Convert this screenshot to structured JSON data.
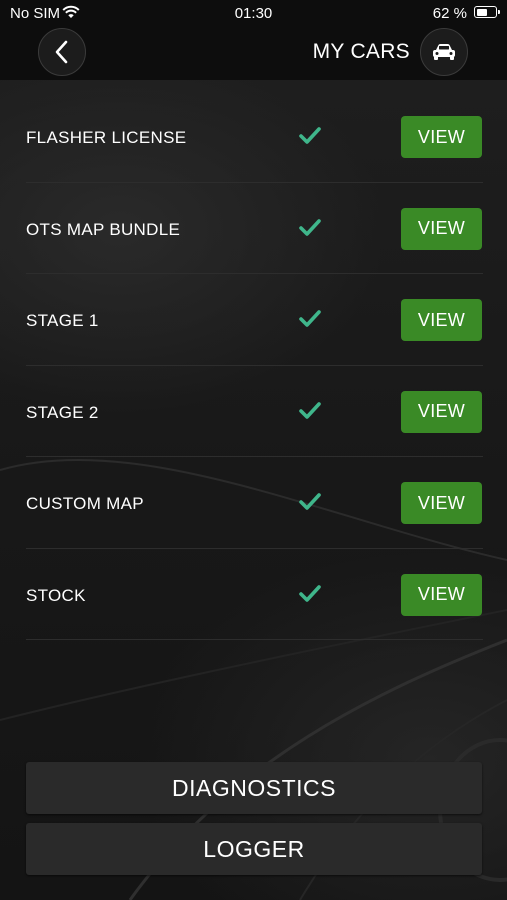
{
  "status_bar": {
    "carrier": "No SIM",
    "time": "01:30",
    "battery_percent": "62 %",
    "battery_level": 0.62
  },
  "header": {
    "title": "MY CARS",
    "back_icon": "chevron-left-icon",
    "car_icon": "car-icon"
  },
  "rows": [
    {
      "label": "FLASHER LICENSE",
      "button": "VIEW"
    },
    {
      "label": "OTS MAP BUNDLE",
      "button": "VIEW"
    },
    {
      "label": "STAGE 1",
      "button": "VIEW"
    },
    {
      "label": "STAGE 2",
      "button": "VIEW"
    },
    {
      "label": "CUSTOM MAP",
      "button": "VIEW"
    },
    {
      "label": "STOCK",
      "button": "VIEW"
    }
  ],
  "actions": {
    "diagnostics": "DIAGNOSTICS",
    "logger": "LOGGER"
  },
  "colors": {
    "accent_green": "#3a8a26",
    "check_color": "#3fb68b",
    "background": "#161616"
  }
}
